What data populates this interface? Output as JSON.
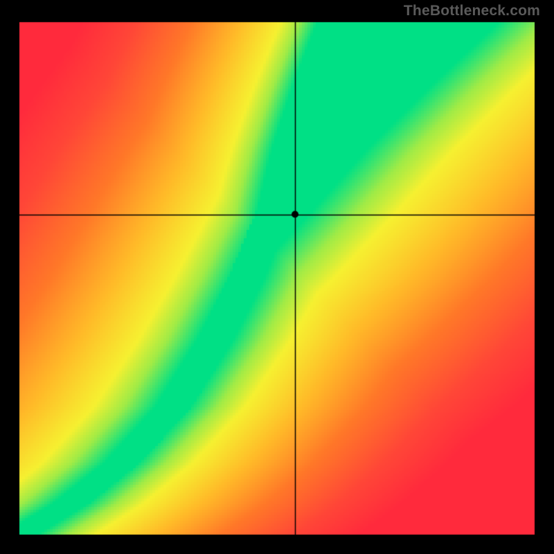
{
  "watermark": "TheBottleneck.com",
  "chart_data": {
    "type": "heatmap",
    "title": "",
    "xlabel": "",
    "ylabel": "",
    "xlim": [
      0,
      1
    ],
    "ylim": [
      0,
      1
    ],
    "colorscale": "red-yellow-green",
    "description": "Bottleneck heatmap. X axis (horizontal) and Y axis (vertical, increasing upward) both normalized 0..1. A narrow green optimal-band curve runs from bottom-left to top-right; away from it the field fades through yellow/orange to red. Black crosshair lines mark a selected point.",
    "optimum_curve_points_xy": [
      [
        0.0,
        0.0
      ],
      [
        0.1,
        0.06
      ],
      [
        0.2,
        0.14
      ],
      [
        0.3,
        0.25
      ],
      [
        0.38,
        0.38
      ],
      [
        0.44,
        0.5
      ],
      [
        0.49,
        0.62
      ],
      [
        0.54,
        0.75
      ],
      [
        0.6,
        0.88
      ],
      [
        0.66,
        1.0
      ]
    ],
    "band_halfwidth_x": 0.035,
    "crosshair": {
      "x": 0.535,
      "y": 0.625
    },
    "marker": {
      "x": 0.535,
      "y": 0.625
    },
    "plot_inset_fraction": {
      "left": 0.035,
      "right": 0.035,
      "top": 0.04,
      "bottom": 0.035
    },
    "colors": {
      "optimal": "#00E085",
      "good": "#F6F030",
      "warn": "#FF8A1F",
      "bad": "#FF2A3C",
      "frame": "#000000"
    }
  }
}
